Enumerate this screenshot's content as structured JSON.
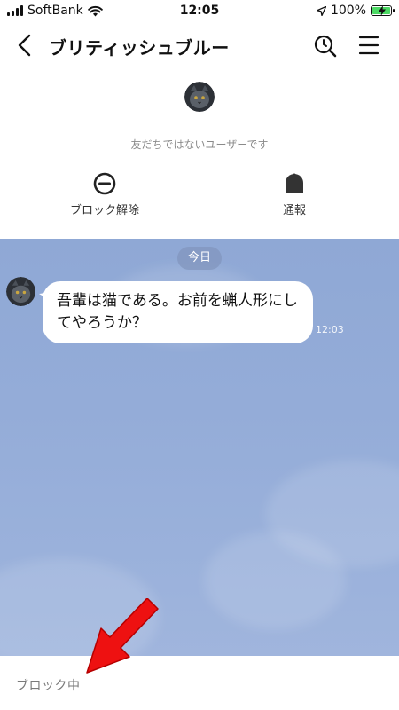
{
  "status_bar": {
    "carrier": "SoftBank",
    "time": "12:05",
    "battery_percent": "100%"
  },
  "header": {
    "title": "ブリティッシュブルー"
  },
  "profile": {
    "notice": "友だちではないユーザーです",
    "actions": [
      {
        "label": "ブロック解除",
        "icon": "unblock-icon"
      },
      {
        "label": "通報",
        "icon": "report-icon"
      }
    ]
  },
  "chat": {
    "date_label": "今日",
    "messages": [
      {
        "text": "吾輩は猫である。お前を蝋人形にしてやろうか？",
        "time": "12:03"
      }
    ]
  },
  "footer": {
    "status": "ブロック中"
  },
  "colors": {
    "chat_background": "#94acd8",
    "arrow": "#ee1111",
    "battery": "#4cd964"
  }
}
